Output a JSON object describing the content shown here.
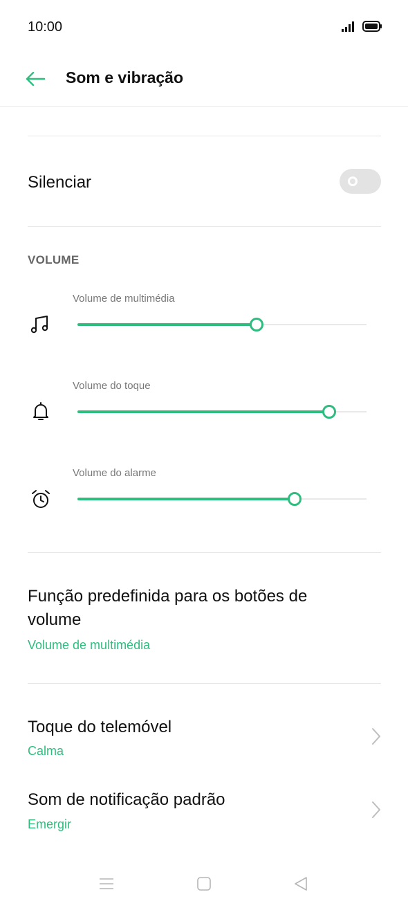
{
  "status_bar": {
    "time": "10:00"
  },
  "header": {
    "title": "Som e vibração"
  },
  "silenciar": {
    "label": "Silenciar",
    "enabled": false
  },
  "volume_section": {
    "heading": "VOLUME"
  },
  "sliders": [
    {
      "label": "Volume de multimédia",
      "icon": "music-note-icon",
      "level": 0.62
    },
    {
      "label": "Volume do toque",
      "icon": "bell-icon",
      "level": 0.87
    },
    {
      "label": "Volume do alarme",
      "icon": "alarm-clock-icon",
      "level": 0.75
    }
  ],
  "volume_buttons": {
    "title": "Função predefinida para os botões de volume",
    "value": "Volume de multimédia"
  },
  "ringtone": {
    "title": "Toque do telemóvel",
    "value": "Calma"
  },
  "notification_sound": {
    "title": "Som de notificação padrão",
    "value": "Emergir"
  },
  "colors": {
    "accent": "#2ebd7e",
    "track": "#e9e9e9",
    "toggle_off": "#e3e3e3"
  }
}
